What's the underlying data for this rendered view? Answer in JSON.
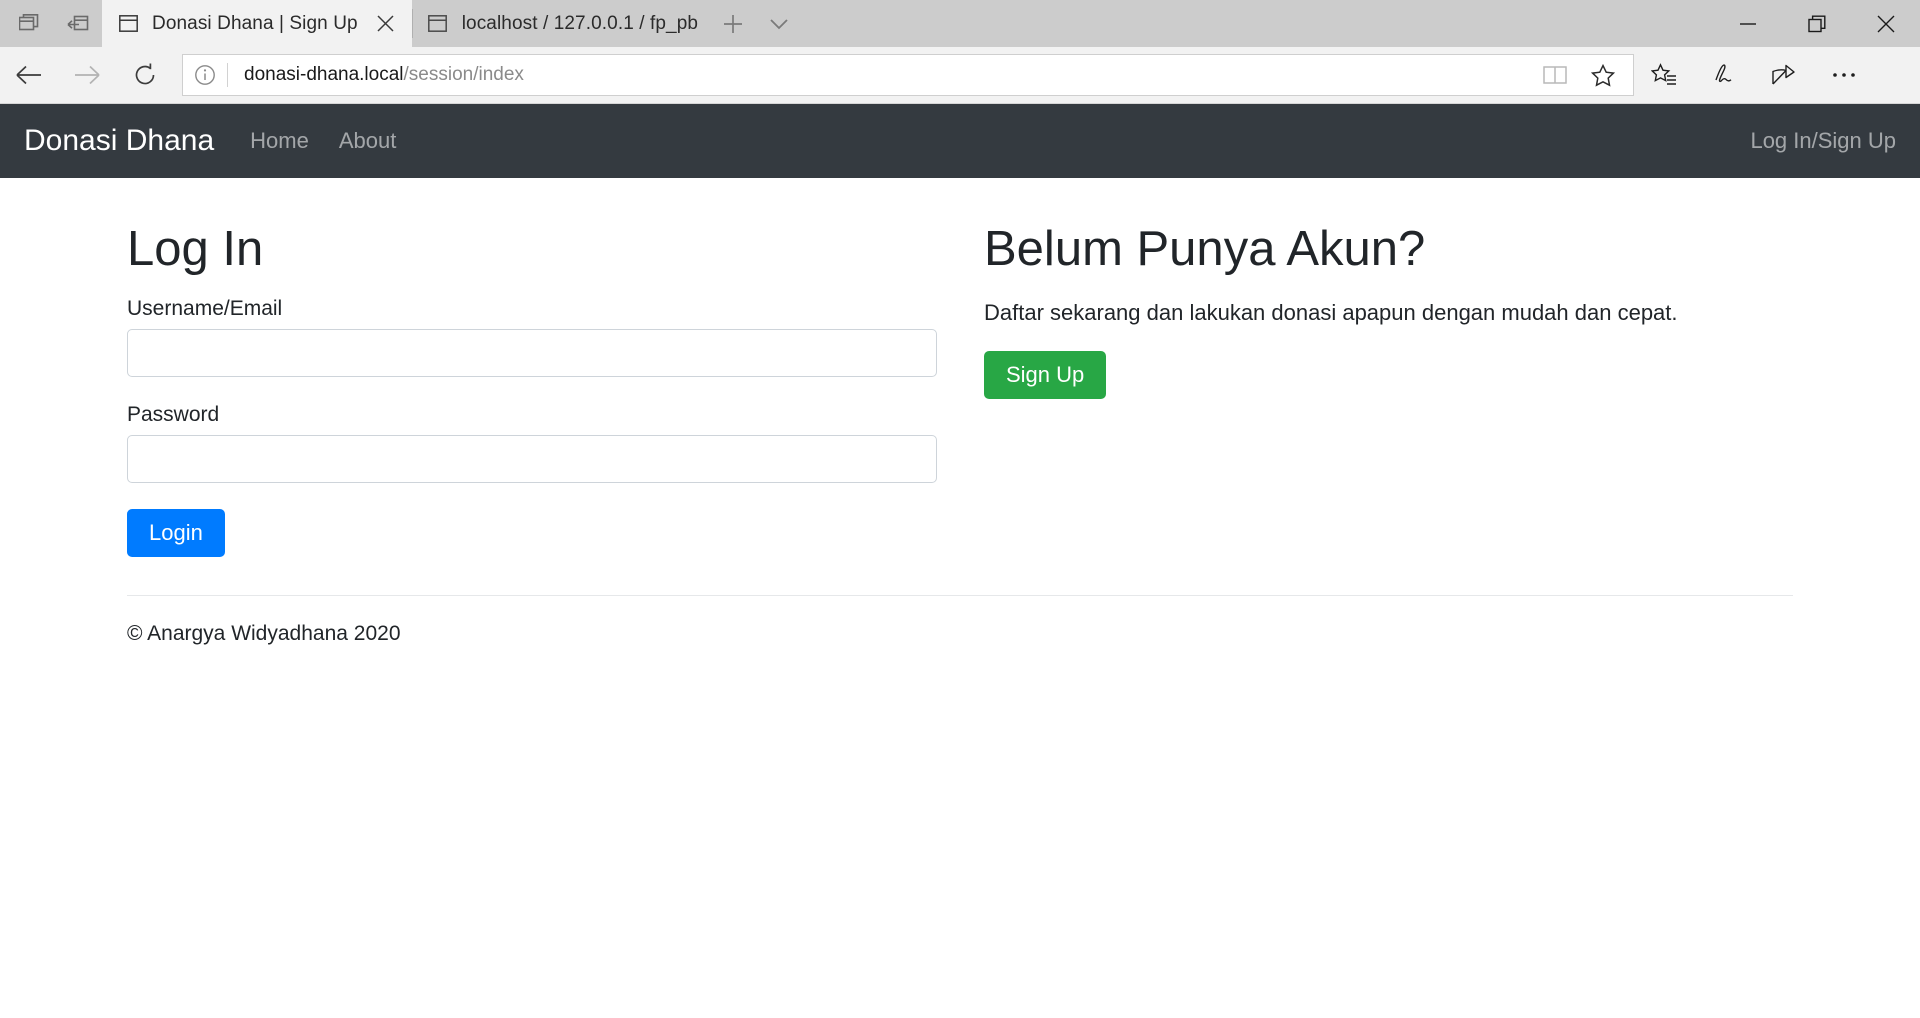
{
  "browser": {
    "left_tools": [
      {
        "name": "tab-preview-icon",
        "label": "Tab preview"
      },
      {
        "name": "set-aside-tabs-icon",
        "label": "Set tabs aside"
      }
    ],
    "tabs": [
      {
        "title": "Donasi Dhana | Sign Up",
        "active": true,
        "close_label": "✕"
      },
      {
        "title": "localhost / 127.0.0.1 / fp_pb",
        "active": false
      }
    ],
    "new_tab_label": "+",
    "tab_dropdown_label": "⌄",
    "window_controls": {
      "minimize": "—",
      "restore": "restore",
      "close": "✕"
    },
    "nav": {
      "back_label": "Back",
      "forward_label": "Forward",
      "refresh_label": "Refresh"
    },
    "url": {
      "domain": "donasi-dhana.local",
      "path": "/session/index",
      "full": "donasi-dhana.local/session/index",
      "info_icon": "info-icon"
    },
    "url_icons": [
      {
        "name": "reading-view-icon"
      },
      {
        "name": "favorite-star-icon"
      }
    ],
    "toolbar_icons": [
      {
        "name": "favorites-hub-icon"
      },
      {
        "name": "web-note-icon"
      },
      {
        "name": "share-icon"
      },
      {
        "name": "settings-more-icon"
      }
    ]
  },
  "site": {
    "navbar": {
      "brand": "Donasi Dhana",
      "links": [
        {
          "label": "Home"
        },
        {
          "label": "About"
        }
      ],
      "auth_link": "Log In/Sign Up"
    },
    "login": {
      "heading": "Log In",
      "username_label": "Username/Email",
      "username_value": "",
      "username_placeholder": "",
      "password_label": "Password",
      "password_value": "",
      "password_placeholder": "",
      "submit_label": "Login"
    },
    "signup": {
      "heading": "Belum Punya Akun?",
      "description": "Daftar sekarang dan lakukan donasi apapun dengan mudah dan cepat.",
      "button_label": "Sign Up"
    },
    "footer": {
      "copyright": "© Anargya Widyadhana 2020"
    },
    "colors": {
      "navbar_bg": "#343a40",
      "primary": "#007bff",
      "success": "#28a745",
      "border": "#ced4da",
      "text": "#212529"
    }
  }
}
